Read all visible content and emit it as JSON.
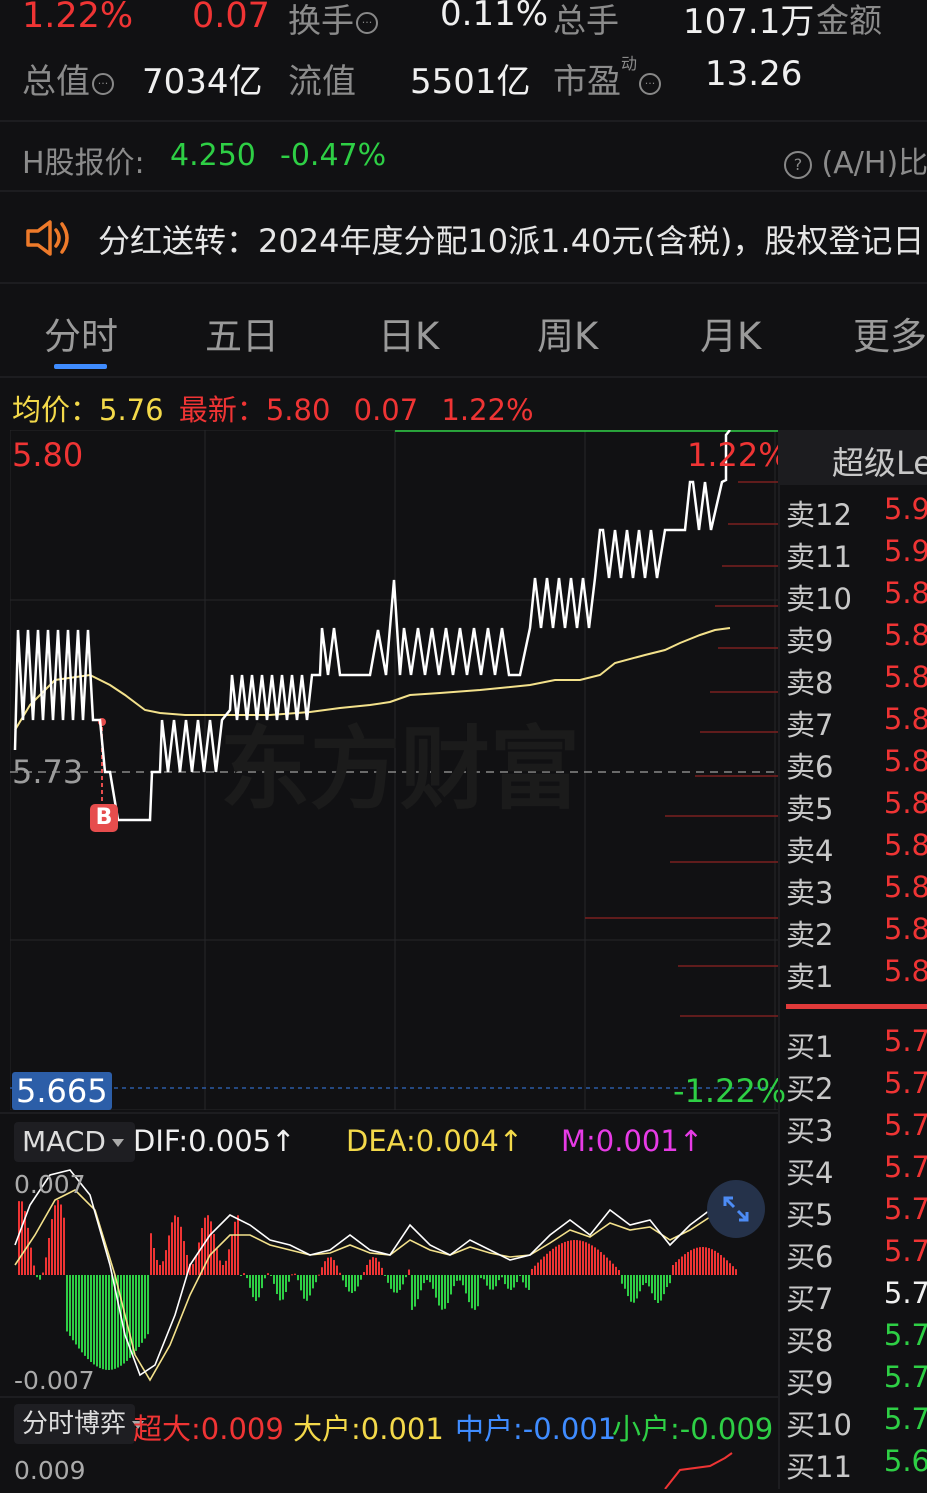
{
  "quote": {
    "change_pct": "1.22%",
    "change_amt": "0.07",
    "turnover_label": "换手",
    "turnover_value": "0.11%",
    "volume_label": "总手",
    "volume_value": "107.1万",
    "amount_label": "金额",
    "mktcap_label": "总值",
    "mktcap_value": "7034亿",
    "float_label": "流值",
    "float_value": "5501亿",
    "pe_label": "市盈",
    "pe_super": "动",
    "pe_value": "13.26"
  },
  "hshare": {
    "label": "H股报价:",
    "price": "4.250",
    "change": "-0.47%",
    "ah_label": "(A/H)比"
  },
  "notice": {
    "text": "分红送转：2024年度分配10派1.40元(含税)，股权登记日"
  },
  "tabs": [
    "分时",
    "五日",
    "日K",
    "周K",
    "月K",
    "更多"
  ],
  "intraday": {
    "avg_label": "均价：",
    "avg_value": "5.76",
    "latest_label": "最新：",
    "latest_value": "5.80",
    "latest_change": "0.07",
    "latest_pct": "1.22%",
    "top_price": "5.80",
    "top_pct": "1.22%",
    "mid_price": "5.73",
    "bottom_price": "5.665",
    "bottom_pct": "-1.22%",
    "marker": "B",
    "watermark": "东方财富"
  },
  "macd": {
    "selector": "MACD",
    "dif": "DIF:0.005",
    "dea": "DEA:0.004",
    "m": "M:0.001",
    "arrow": "↑",
    "top": "0.007",
    "bottom": "-0.007"
  },
  "flow": {
    "selector": "分时博弈",
    "super": "超大:0.009",
    "large": "大户:0.001",
    "medium": "中户:-0.001",
    "small": "小户:-0.009",
    "top": "0.009"
  },
  "orderbook": {
    "title": "超级Le",
    "sells": [
      {
        "label": "卖12",
        "price": "5.9"
      },
      {
        "label": "卖11",
        "price": "5.9"
      },
      {
        "label": "卖10",
        "price": "5.8"
      },
      {
        "label": "卖9",
        "price": "5.8"
      },
      {
        "label": "卖8",
        "price": "5.8"
      },
      {
        "label": "卖7",
        "price": "5.8"
      },
      {
        "label": "卖6",
        "price": "5.8"
      },
      {
        "label": "卖5",
        "price": "5.8"
      },
      {
        "label": "卖4",
        "price": "5.8"
      },
      {
        "label": "卖3",
        "price": "5.8"
      },
      {
        "label": "卖2",
        "price": "5.8"
      },
      {
        "label": "卖1",
        "price": "5.8"
      }
    ],
    "buys": [
      {
        "label": "买1",
        "price": "5.7"
      },
      {
        "label": "买2",
        "price": "5.7"
      },
      {
        "label": "买3",
        "price": "5.7"
      },
      {
        "label": "买4",
        "price": "5.7"
      },
      {
        "label": "买5",
        "price": "5.7"
      },
      {
        "label": "买6",
        "price": "5.7"
      },
      {
        "label": "买7",
        "price": "5.7"
      },
      {
        "label": "买8",
        "price": "5.7"
      },
      {
        "label": "买9",
        "price": "5.7"
      },
      {
        "label": "买10",
        "price": "5.7"
      },
      {
        "label": "买11",
        "price": "5.6"
      }
    ]
  },
  "colors": {
    "up": "#ef3434",
    "down": "#2ecf45",
    "avg_line": "#f3e18b",
    "price_line": "#ffffff",
    "dea_line": "#f3e18b"
  }
}
